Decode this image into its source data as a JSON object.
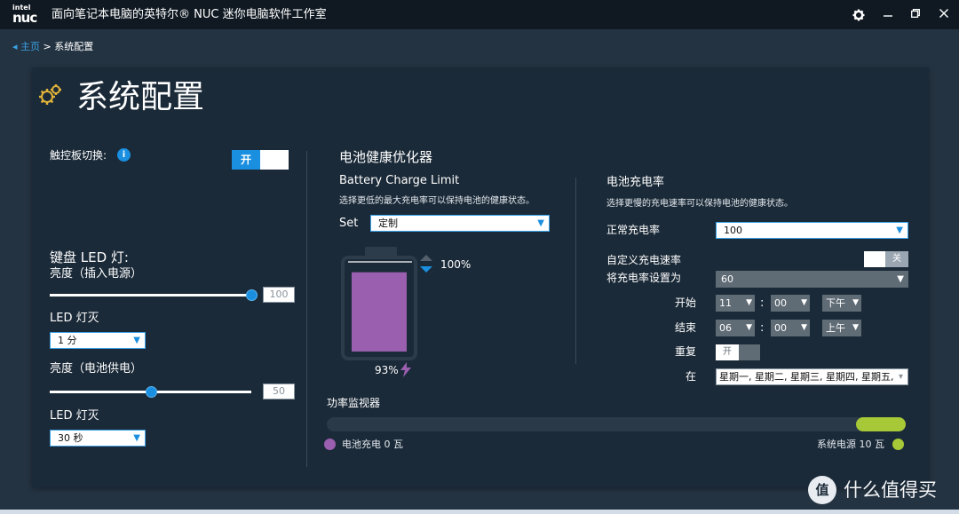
{
  "titlebar": {
    "logo_top": "intel",
    "logo_bottom": "nuc",
    "title": "面向笔记本电脑的英特尔® NUC 迷你电脑软件工作室",
    "icons": [
      "gear-icon",
      "minimize-icon",
      "restore-icon",
      "close-icon"
    ]
  },
  "breadcrumb": {
    "home": "主页",
    "sep": ">",
    "current": "系统配置"
  },
  "page": {
    "title": "系统配置"
  },
  "touchpad": {
    "label": "触控板切换:",
    "toggle": "开",
    "toggle_on": true
  },
  "keyboard": {
    "heading": "键盘 LED 灯:",
    "plugged": {
      "label": "亮度（插入电源）",
      "value": "100",
      "level": 100,
      "off_label": "LED 灯灭",
      "off_value": "1 分"
    },
    "battery": {
      "label": "亮度（电池供电）",
      "value": "50",
      "level": 50,
      "off_label": "LED 灯灭",
      "off_value": "30 秒"
    }
  },
  "optimizer": {
    "heading": "电池健康优化器",
    "limit_title": "Battery Charge Limit",
    "limit_desc": "选择更低的最大充电率可以保持电池的健康状态。",
    "set_label": "Set",
    "set_value": "定制",
    "limit_percent": "100%",
    "charge_percent": "93%",
    "charge_level": 93
  },
  "charge_rate": {
    "heading": "电池充电率",
    "desc": "选择更慢的充电速率可以保持电池的健康状态。",
    "normal_label": "正常充电率",
    "normal_value": "100",
    "custom_label": "自定义充电速率",
    "custom_toggle": "关",
    "set_rate_label": "将充电率设置为",
    "set_rate_value": "60",
    "start_label": "开始",
    "start_hour": "11",
    "start_min": "00",
    "start_ampm": "下午",
    "end_label": "结束",
    "end_hour": "06",
    "end_min": "00",
    "end_ampm": "上午",
    "colon": ":",
    "repeat_label": "重复",
    "repeat_toggle": "开",
    "on_label": "在",
    "days_value": "星期一, 星期二, 星期三, 星期四, 星期五,"
  },
  "power_monitor": {
    "heading": "功率监视器",
    "battery_label": "电池充电 0 瓦",
    "system_label": "系统电源 10 瓦",
    "battery_color": "#9b5fb0",
    "system_color": "#a7c837"
  },
  "watermark": {
    "text": "什么值得买",
    "icon": "值"
  },
  "colors": {
    "accent": "#1a8fe0",
    "battery_fill": "#9b5fb0",
    "charge_bolt": "#9b5fb0",
    "monitor_fill": "#a7c837"
  }
}
